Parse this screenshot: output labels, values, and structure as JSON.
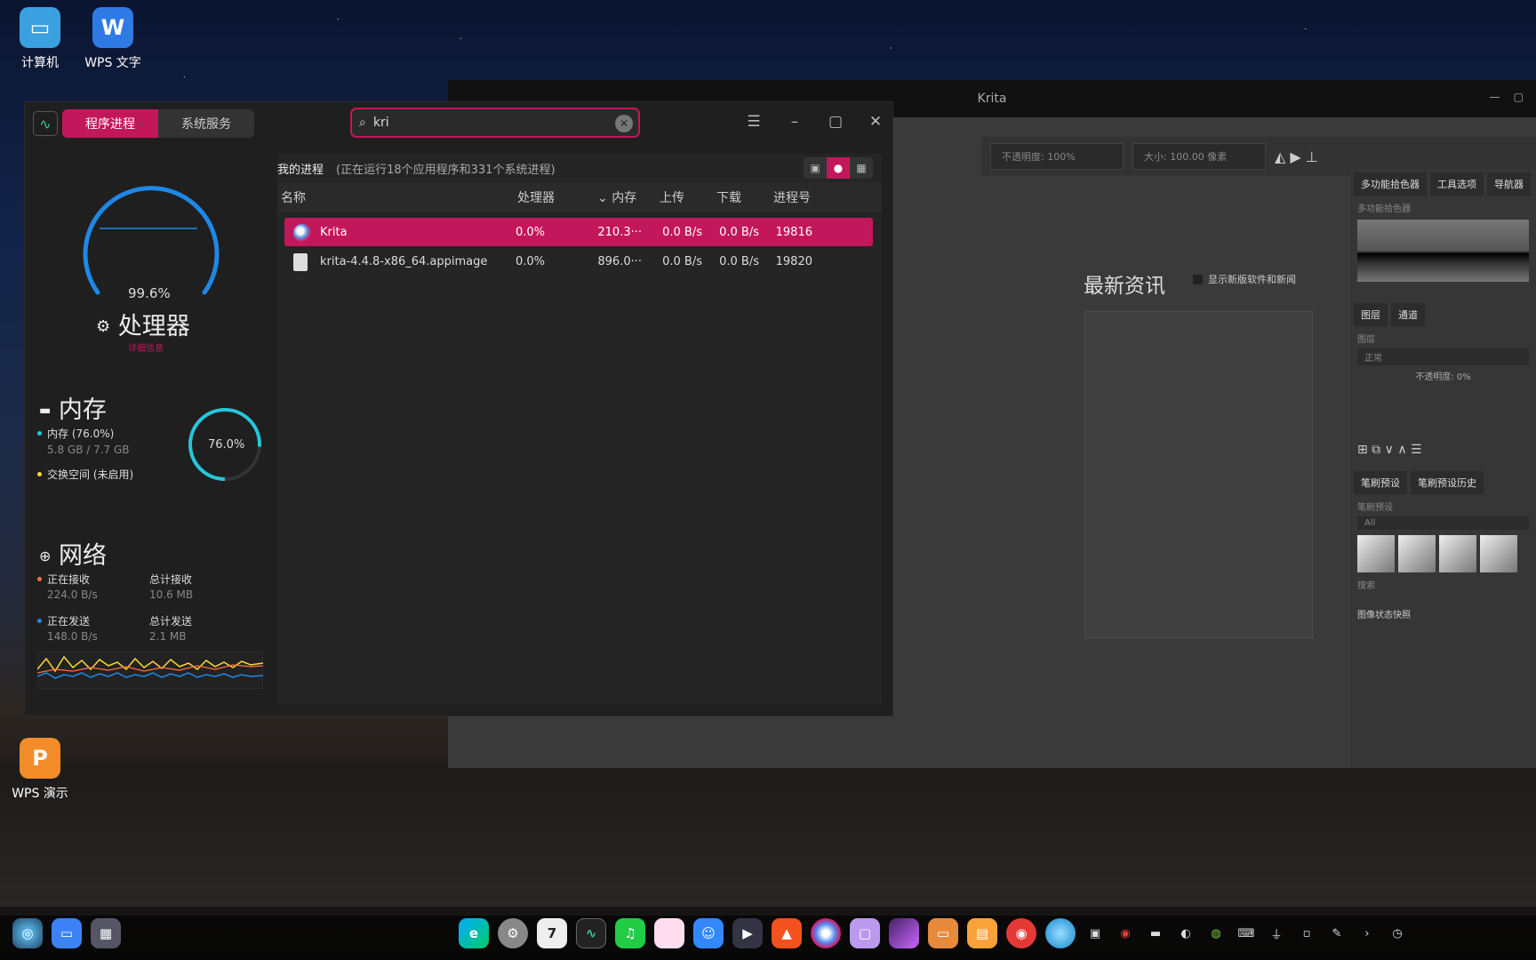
{
  "desktop": {
    "icons": [
      {
        "label": "计算机"
      },
      {
        "label": "WPS 文字"
      },
      {
        "label": "WPS 演示"
      }
    ]
  },
  "krita": {
    "title": "Krita",
    "opacity": "不透明度: 100%",
    "size": "大小: 100.00 像素",
    "news_title": "最新资讯",
    "news_check": "显示新版软件和新闻",
    "dock_tabs": [
      "多功能拾色器",
      "工具选项",
      "导航器"
    ],
    "dock_sub": "多功能拾色器",
    "layer_tabs": [
      "图层",
      "通道"
    ],
    "layer_sub": "图层",
    "blend": "正常",
    "layer_opacity": "不透明度: 0%",
    "brush_tabs": [
      "笔刷预设",
      "笔刷预设历史"
    ],
    "brush_sub": "笔刷预设",
    "brush_filter": "All",
    "search": "搜索",
    "snapshot": "图像状态快照"
  },
  "monitor": {
    "tabs": [
      "程序进程",
      "系统服务"
    ],
    "search": {
      "value": "kri"
    },
    "cpu": {
      "percent": "99.6%",
      "label": "处理器",
      "detail": "详细信息",
      "accent": "#1e88e5"
    },
    "memory": {
      "title": "内存",
      "mem_label": "内存 (76.0%)",
      "mem_value": "5.8 GB / 7.7 GB",
      "swap_label": "交换空间 (未启用)",
      "percent": "76.0%",
      "accent": "#26c6da"
    },
    "network": {
      "title": "网络",
      "recv_label": "正在接收",
      "recv_value": "224.0 B/s",
      "total_recv_label": "总计接收",
      "total_recv_value": "10.6 MB",
      "send_label": "正在发送",
      "send_value": "148.0 B/s",
      "total_send_label": "总计发送",
      "total_send_value": "2.1 MB"
    },
    "header": {
      "title": "我的进程",
      "summary": "(正在运行18个应用程序和331个系统进程)"
    },
    "columns": [
      "名称",
      "处理器",
      "内存",
      "上传",
      "下载",
      "进程号"
    ],
    "rows": [
      {
        "name": "Krita",
        "cpu": "0.0%",
        "mem": "210.3···",
        "up": "0.0 B/s",
        "down": "0.0 B/s",
        "pid": "19816"
      },
      {
        "name": "krita-4.4.8-x86_64.appimage",
        "cpu": "0.0%",
        "mem": "896.0···",
        "up": "0.0 B/s",
        "down": "0.0 B/s",
        "pid": "19820"
      }
    ]
  }
}
